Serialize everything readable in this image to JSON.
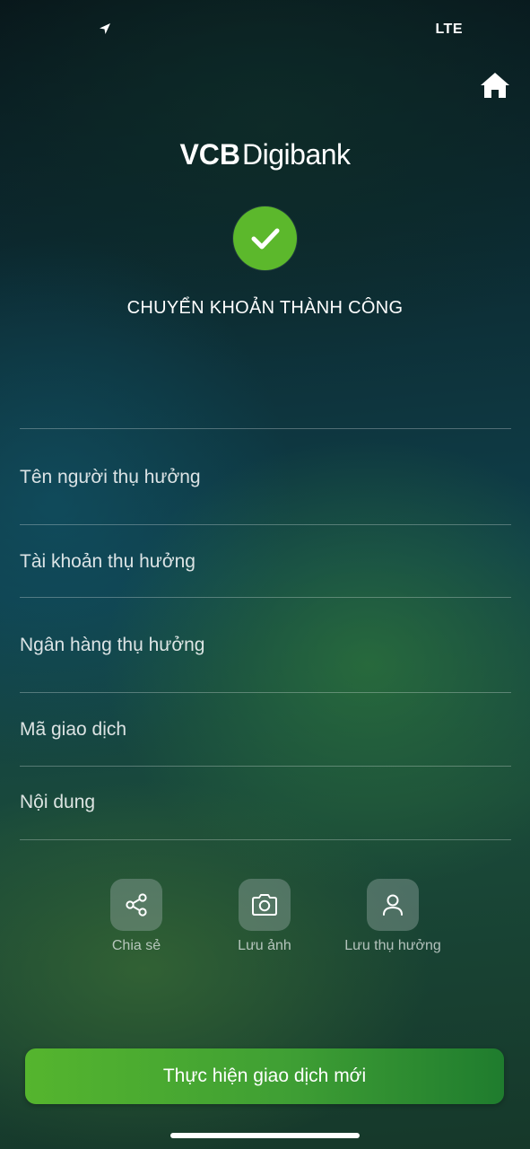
{
  "status_bar": {
    "network": "LTE",
    "location_icon": "location-arrow-icon"
  },
  "header": {
    "home_icon": "home-icon"
  },
  "brand": {
    "logo_bold": "VCB",
    "logo_light": "Digibank"
  },
  "result": {
    "status_icon": "check-icon",
    "status_color": "#5cb82c",
    "title": "CHUYỂN KHOẢN THÀNH CÔNG"
  },
  "details": [
    {
      "label": "Tên người thụ hưởng"
    },
    {
      "label": "Tài khoản thụ hưởng"
    },
    {
      "label": "Ngân hàng thụ hưởng"
    },
    {
      "label": "Mã giao dịch"
    },
    {
      "label": "Nội dung"
    }
  ],
  "actions": [
    {
      "label": "Chia sẻ",
      "icon": "share-icon"
    },
    {
      "label": "Lưu ảnh",
      "icon": "camera-icon"
    },
    {
      "label": "Lưu thụ hưởng",
      "icon": "user-icon"
    }
  ],
  "primary_button": {
    "label": "Thực hiện giao dịch mới",
    "color": "#4caf32"
  }
}
